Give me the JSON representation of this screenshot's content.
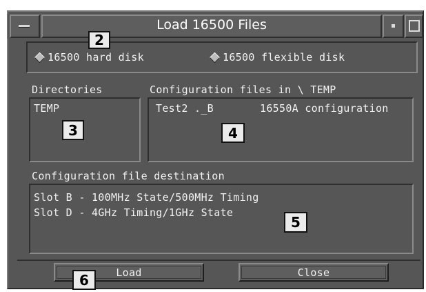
{
  "window": {
    "title": "Load 16500 Files"
  },
  "source": {
    "options": [
      {
        "label": "16500 hard disk",
        "selected": true
      },
      {
        "label": "16500 flexible disk",
        "selected": false
      }
    ]
  },
  "directories": {
    "label": "Directories",
    "items": [
      "TEMP"
    ]
  },
  "config_files": {
    "label": "Configuration files in \\ TEMP",
    "items": [
      {
        "name": "Test2 ._B",
        "type": "16550A configuration"
      }
    ]
  },
  "destination": {
    "label": "Configuration file destination",
    "items": [
      "Slot B - 100MHz State/500MHz Timing",
      "Slot D - 4GHz Timing/1GHz State"
    ]
  },
  "buttons": {
    "load": "Load",
    "close": "Close"
  },
  "callouts": {
    "c2": "2",
    "c3": "3",
    "c4": "4",
    "c5": "5",
    "c6": "6"
  },
  "colors": {
    "panel": "#565656",
    "text": "#f2f2f2",
    "callout_bg": "#ebebeb"
  }
}
